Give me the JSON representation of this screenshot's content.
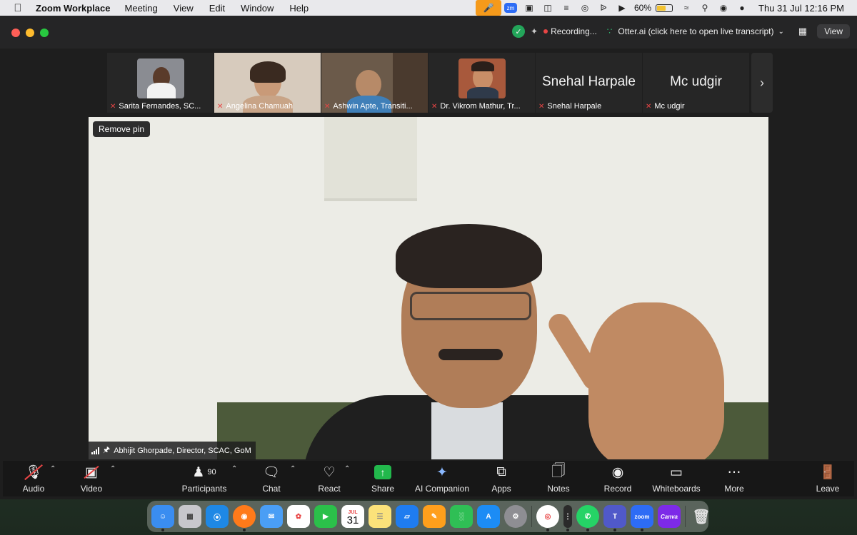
{
  "menubar": {
    "app_name": "Zoom Workplace",
    "menus": [
      "Meeting",
      "View",
      "Edit",
      "Window",
      "Help"
    ],
    "zoom_badge": "zm",
    "battery_pct": "60%",
    "battery_level": 0.6,
    "clock": "Thu 31 Jul  12:16 PM"
  },
  "titlebar": {
    "recording": "Recording...",
    "otter": "Otter.ai (click here to open live transcript)",
    "view": "View"
  },
  "filmstrip": [
    {
      "name": "Sarita Fernandes, SC...",
      "type": "photo"
    },
    {
      "name": "Angelina Chamuah",
      "type": "video"
    },
    {
      "name": "Ashwin Apte, Transiti...",
      "type": "video"
    },
    {
      "name": "Dr. Vikrom Mathur, Tr...",
      "type": "photo"
    },
    {
      "name": "Snehal Harpale",
      "display": "Snehal Harpale",
      "type": "name"
    },
    {
      "name": "Mc udgir",
      "display": "Mc udgir",
      "type": "name"
    }
  ],
  "main": {
    "remove_pin": "Remove pin",
    "speaker": "Abhijit Ghorpade, Director, SCAC, GoM"
  },
  "toolbar": {
    "audio": "Audio",
    "video": "Video",
    "participants": "Participants",
    "participants_count": "90",
    "chat": "Chat",
    "react": "React",
    "share": "Share",
    "ai_companion": "AI Companion",
    "apps": "Apps",
    "notes": "Notes",
    "record": "Record",
    "whiteboards": "Whiteboards",
    "more": "More",
    "leave": "Leave"
  },
  "dock": {
    "calendar_month": "JUL",
    "calendar_day": "31",
    "zoom_label": "zoom",
    "canva_label": "Canva"
  },
  "colors": {
    "muted_red": "#e84545",
    "share_green": "#22b84c",
    "recording_red": "#e84545",
    "shield_green": "#23a55a"
  }
}
